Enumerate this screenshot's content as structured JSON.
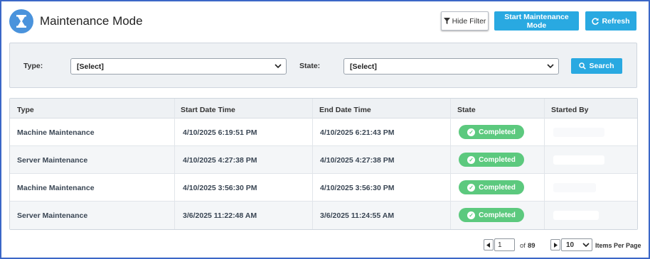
{
  "header": {
    "title": "Maintenance Mode",
    "logo_icon": "hourglass-icon",
    "hide_filter_label": "Hide Filter",
    "start_maintenance_label": "Start Maintenance Mode",
    "refresh_label": "Refresh"
  },
  "filter": {
    "type_label": "Type:",
    "type_value": "[Select]",
    "state_label": "State:",
    "state_value": "[Select]",
    "search_label": "Search"
  },
  "table": {
    "columns": [
      "Type",
      "Start Date Time",
      "End Date Time",
      "State",
      "Started By"
    ],
    "rows": [
      {
        "type": "Machine Maintenance",
        "start": "4/10/2025 6:19:51 PM",
        "end": "4/10/2025 6:21:43 PM",
        "state": "Completed",
        "started_by": ""
      },
      {
        "type": "Server Maintenance",
        "start": "4/10/2025 4:27:38 PM",
        "end": "4/10/2025 4:27:38 PM",
        "state": "Completed",
        "started_by": ""
      },
      {
        "type": "Machine Maintenance",
        "start": "4/10/2025 3:56:30 PM",
        "end": "4/10/2025 3:56:30 PM",
        "state": "Completed",
        "started_by": ""
      },
      {
        "type": "Server Maintenance",
        "start": "3/6/2025 11:22:48 AM",
        "end": "3/6/2025 11:24:55 AM",
        "state": "Completed",
        "started_by": ""
      }
    ]
  },
  "pagination": {
    "prev_icon": "triangle-left-icon",
    "page": "1",
    "of_label": "of",
    "total_pages": "89",
    "next_icon": "triangle-right-icon",
    "page_size": "10",
    "items_per_page_label": "Items Per Page"
  },
  "colors": {
    "accent": "#29a9e1",
    "logo": "#4a93dc",
    "completed": "#5cc97e",
    "frame": "#3b67c7"
  }
}
